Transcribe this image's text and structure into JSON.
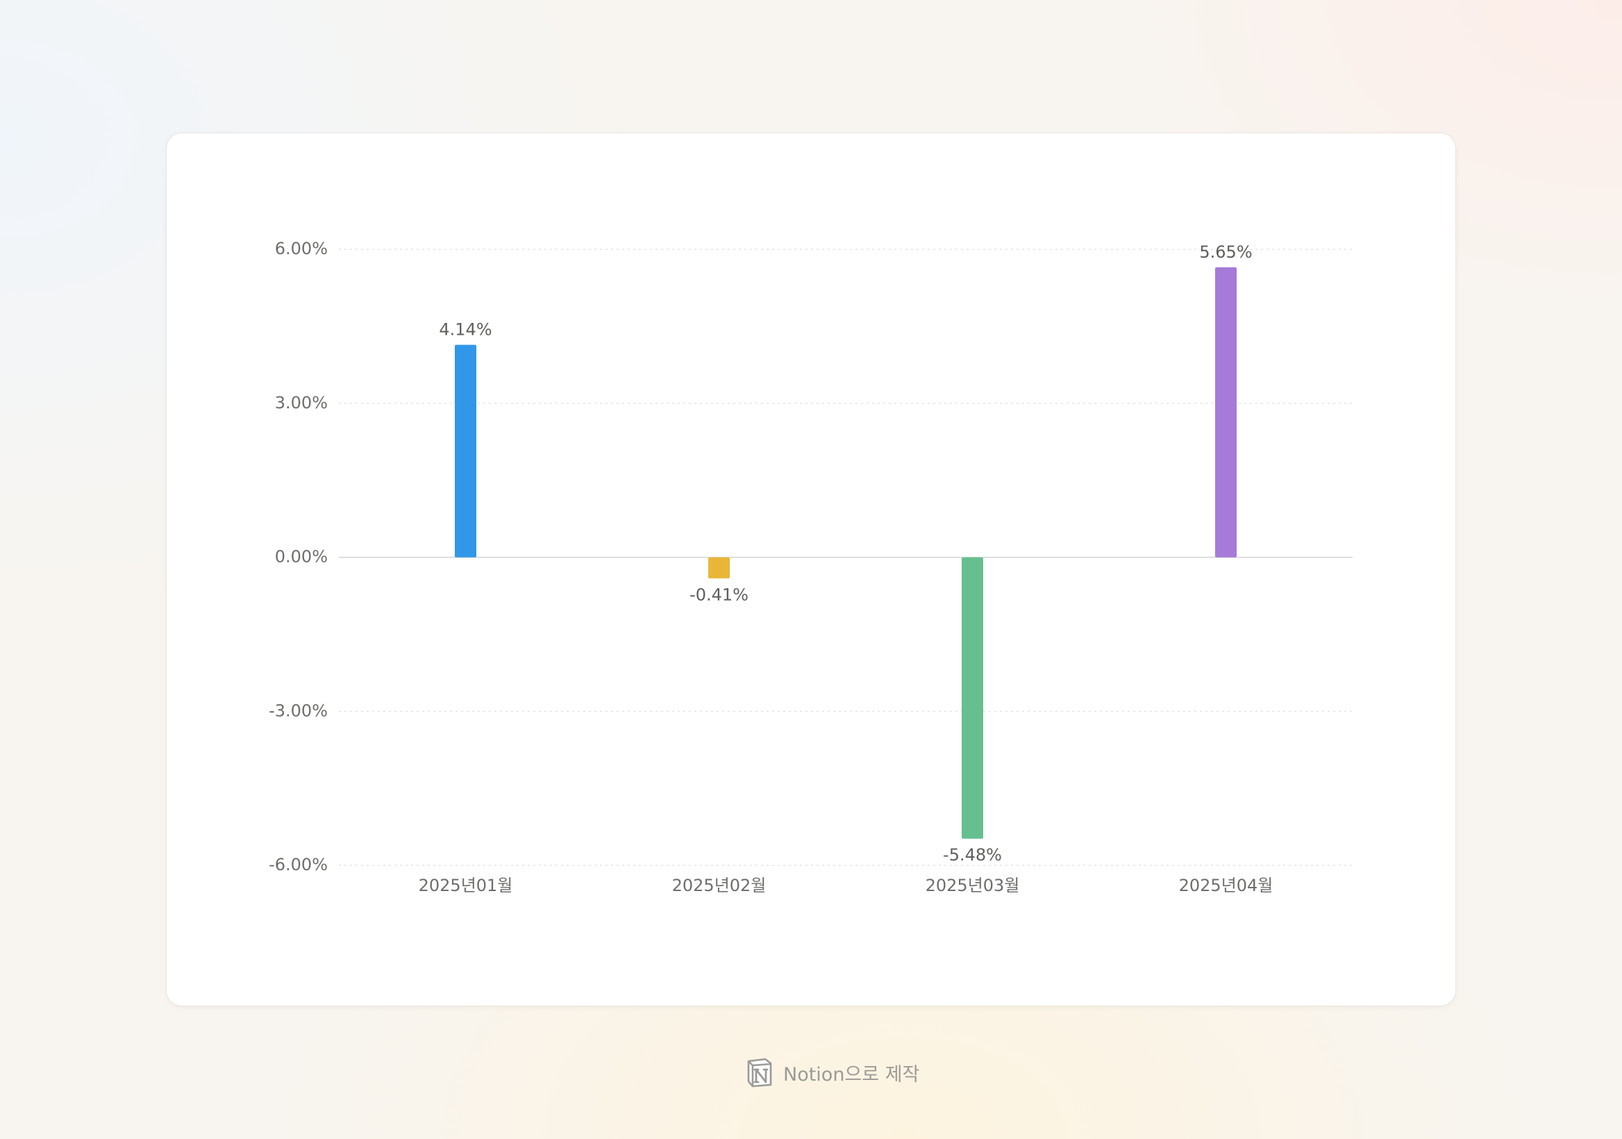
{
  "chart_data": {
    "type": "bar",
    "categories": [
      "2025년01월",
      "2025년02월",
      "2025년03월",
      "2025년04월"
    ],
    "values": [
      4.14,
      -0.41,
      -5.48,
      5.65
    ],
    "value_labels": [
      "4.14%",
      "-0.41%",
      "-5.48%",
      "5.65%"
    ],
    "colors": [
      "#3197e8",
      "#e8b738",
      "#66bf8f",
      "#a57ad9"
    ],
    "ylim": [
      -6,
      6
    ],
    "yticks": [
      6,
      3,
      0,
      -3,
      -6
    ],
    "ytick_labels": [
      "6.00%",
      "3.00%",
      "0.00%",
      "-3.00%",
      "-6.00%"
    ],
    "grid": true,
    "legend": false,
    "title": "",
    "xlabel": "",
    "ylabel": ""
  },
  "footer": {
    "icon": "notion-logo-icon",
    "text": "Notion으로 제작"
  }
}
